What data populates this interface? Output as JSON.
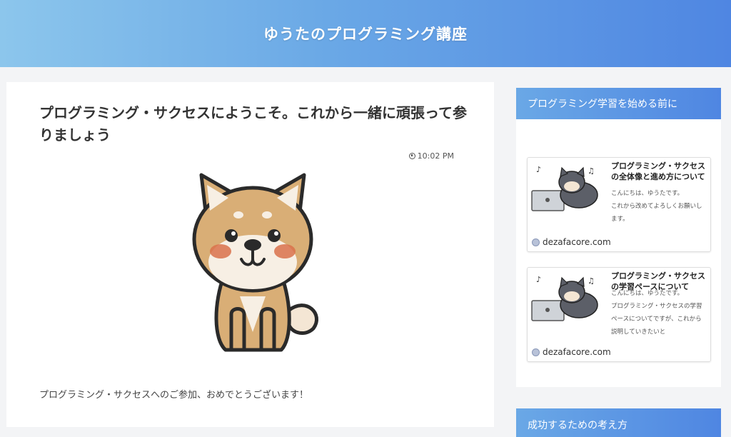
{
  "site": {
    "title": "ゆうたのプログラミング講座"
  },
  "post": {
    "title": "プログラミング・サクセスにようこそ。これから一緒に頑張って参りましょう",
    "time": "10:02 PM",
    "body": "プログラミング・サクセスへのご参加、おめでとうございます！"
  },
  "sidebar": {
    "widget1_title": "プログラミング学習を始める前に",
    "cards": [
      {
        "title": "プログラミング・サクセスの全体像と進め方について",
        "excerpt": "こんにちは、ゆうたです。\nこれから改めてよろしくお願いします。",
        "domain": "dezafacore.com"
      },
      {
        "title": "プログラミング・サクセスの学習ペースについて",
        "excerpt": "こんにちは、ゆうたです。\nプログラミング・サクセスの学習ペースについてですが、これから説明していきたいと",
        "domain": "dezafacore.com"
      }
    ],
    "widget2_title": "成功するための考え方"
  },
  "icons": [
    "clock-icon",
    "globe-icon"
  ],
  "colors": {
    "header_start": "#8cc6ec",
    "header_end": "#4f86e2",
    "widget": "#5b92e4"
  }
}
